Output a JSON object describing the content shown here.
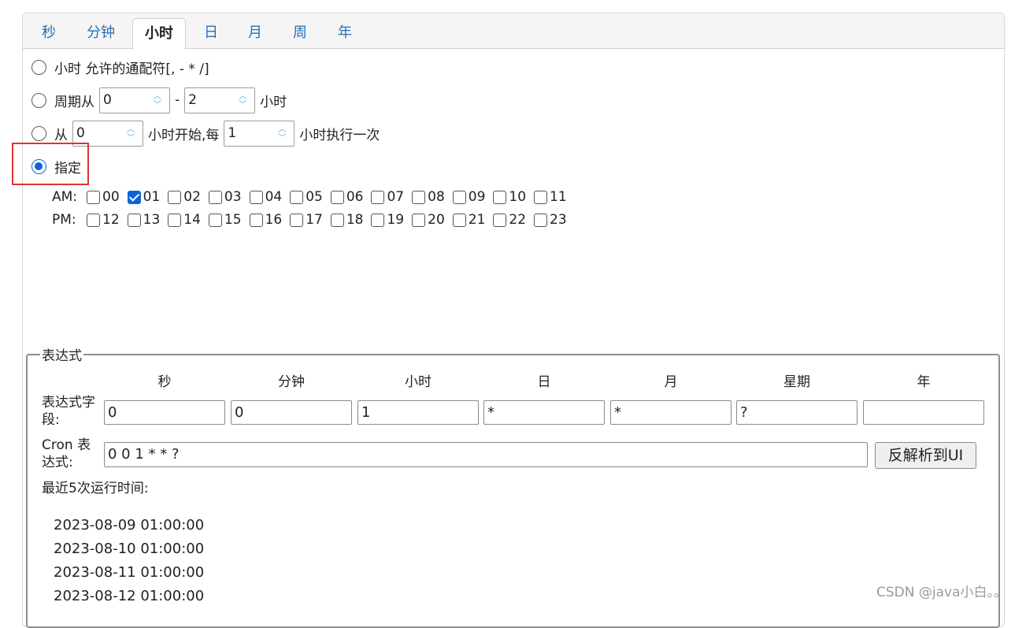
{
  "tabs": [
    {
      "label": "秒",
      "active": false
    },
    {
      "label": "分钟",
      "active": false
    },
    {
      "label": "小时",
      "active": true
    },
    {
      "label": "日",
      "active": false
    },
    {
      "label": "月",
      "active": false
    },
    {
      "label": "周",
      "active": false
    },
    {
      "label": "年",
      "active": false
    }
  ],
  "options": {
    "wildcard": {
      "label": "小时 允许的通配符[, - * /]",
      "selected": false
    },
    "period": {
      "label": "周期从",
      "from": "0",
      "sep": "-",
      "to": "2",
      "unit": "小时",
      "selected": false
    },
    "interval": {
      "label": "从",
      "start": "0",
      "mid": "小时开始,每",
      "every": "1",
      "suffix": "小时执行一次",
      "selected": false
    },
    "specify": {
      "label": "指定",
      "selected": true
    }
  },
  "hours": {
    "am_label": "AM:",
    "pm_label": "PM:",
    "am": [
      {
        "h": "00",
        "checked": false
      },
      {
        "h": "01",
        "checked": true
      },
      {
        "h": "02",
        "checked": false
      },
      {
        "h": "03",
        "checked": false
      },
      {
        "h": "04",
        "checked": false
      },
      {
        "h": "05",
        "checked": false
      },
      {
        "h": "06",
        "checked": false
      },
      {
        "h": "07",
        "checked": false
      },
      {
        "h": "08",
        "checked": false
      },
      {
        "h": "09",
        "checked": false
      },
      {
        "h": "10",
        "checked": false
      },
      {
        "h": "11",
        "checked": false
      }
    ],
    "pm": [
      {
        "h": "12",
        "checked": false
      },
      {
        "h": "13",
        "checked": false
      },
      {
        "h": "14",
        "checked": false
      },
      {
        "h": "15",
        "checked": false
      },
      {
        "h": "16",
        "checked": false
      },
      {
        "h": "17",
        "checked": false
      },
      {
        "h": "18",
        "checked": false
      },
      {
        "h": "19",
        "checked": false
      },
      {
        "h": "20",
        "checked": false
      },
      {
        "h": "21",
        "checked": false
      },
      {
        "h": "22",
        "checked": false
      },
      {
        "h": "23",
        "checked": false
      }
    ]
  },
  "expression": {
    "legend": "表达式",
    "columns": [
      "秒",
      "分钟",
      "小时",
      "日",
      "月",
      "星期",
      "年"
    ],
    "field_label": "表达式字段:",
    "fields": [
      "0",
      "0",
      "1",
      "*",
      "*",
      "?",
      ""
    ],
    "cron_label": "Cron 表达式:",
    "cron_value": "0 0 1 * * ?",
    "parse_button": "反解析到UI",
    "recent_label": "最近5次运行时间:",
    "recent_runs": [
      "2023-08-09 01:00:00",
      "2023-08-10 01:00:00",
      "2023-08-11 01:00:00",
      "2023-08-12 01:00:00"
    ]
  },
  "watermark": "CSDN @java小白。。"
}
